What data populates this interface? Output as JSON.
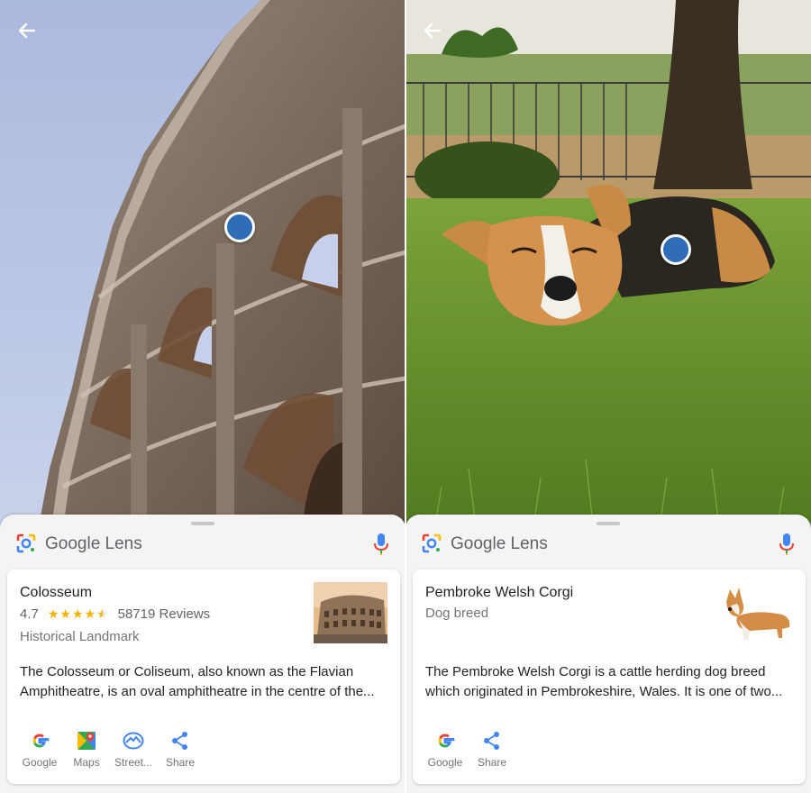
{
  "app": {
    "name": "Google Lens"
  },
  "left": {
    "result": {
      "title": "Colosseum",
      "rating": "4.7",
      "stars": "★★★★",
      "half_star": "★",
      "reviews": "58719 Reviews",
      "category": "Historical Landmark",
      "description": "The Colosseum or Coliseum, also known as the Flavian Amphitheatre, is an oval amphitheatre in the centre of the..."
    },
    "actions": [
      {
        "label": "Google",
        "icon": "google-icon"
      },
      {
        "label": "Maps",
        "icon": "maps-icon"
      },
      {
        "label": "Street...",
        "icon": "street-view-icon"
      },
      {
        "label": "Share",
        "icon": "share-icon"
      }
    ]
  },
  "right": {
    "result": {
      "title": "Pembroke Welsh Corgi",
      "category": "Dog breed",
      "description": "The Pembroke Welsh Corgi is a cattle herding dog breed which originated in Pembrokeshire, Wales. It is one of two..."
    },
    "actions": [
      {
        "label": "Google",
        "icon": "google-icon"
      },
      {
        "label": "Share",
        "icon": "share-icon"
      }
    ]
  },
  "colors": {
    "accent": "#2f6db8",
    "star": "#f4b400",
    "google_blue": "#4285f4",
    "google_red": "#ea4335",
    "google_yellow": "#fbbc05",
    "google_green": "#34a853"
  }
}
